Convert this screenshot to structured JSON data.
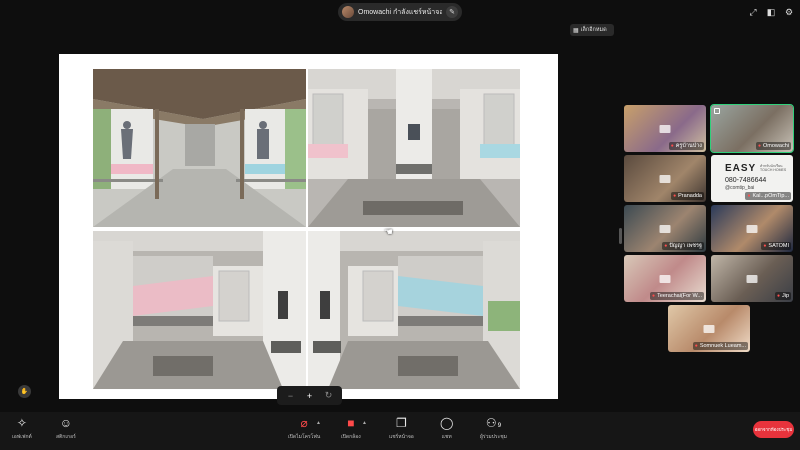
{
  "header": {
    "presenter_text": "Omowachi กำลังแชร์หน้าจอ",
    "sidebar_toggle_label": "เล็กอีกหมด"
  },
  "zoom_controls": [
    "−",
    "+",
    "↻"
  ],
  "participants": [
    {
      "name": "",
      "speaking": false
    },
    {
      "name": "Omowachi",
      "speaking": true
    },
    {
      "name": "Pranadda",
      "speaking": false
    },
    {
      "name": "Kal...pOmTip...",
      "speaking": false
    },
    {
      "name": "ปัญญา เพชรฐ",
      "speaking": false
    },
    {
      "name": "SATOMI",
      "speaking": false
    },
    {
      "name": "Teerachai(For W...",
      "speaking": false
    },
    {
      "name": "Jip",
      "speaking": false
    },
    {
      "name": "Somnuek  Lueam...",
      "speaking": false
    }
  ],
  "participant_first_label": "ครูบ้านป่าง",
  "easy_card": {
    "logo": "EASY",
    "subtitle": "สำหรับนักเรียน TOUCH HOMES",
    "phone": "080-7486644",
    "line": "@comtip_bai"
  },
  "toolbar": {
    "effects_label": "เอฟเฟกต์",
    "reactions_label": "สติกเกอร์",
    "mic_label": "เปิดไมโครโฟน",
    "camera_label": "เปิดกล้อง",
    "share_label": "แชร์หน้าจอ",
    "chat_label": "แชท",
    "participants_label": "ผู้ร่วมประชุม",
    "participants_count": "9",
    "leave_label": "ออกจากห้องประชุม"
  },
  "colors": {
    "accent_green": "#2fd07a",
    "leave_red": "#e8333c",
    "mic_off_red": "#ff4a4a"
  }
}
